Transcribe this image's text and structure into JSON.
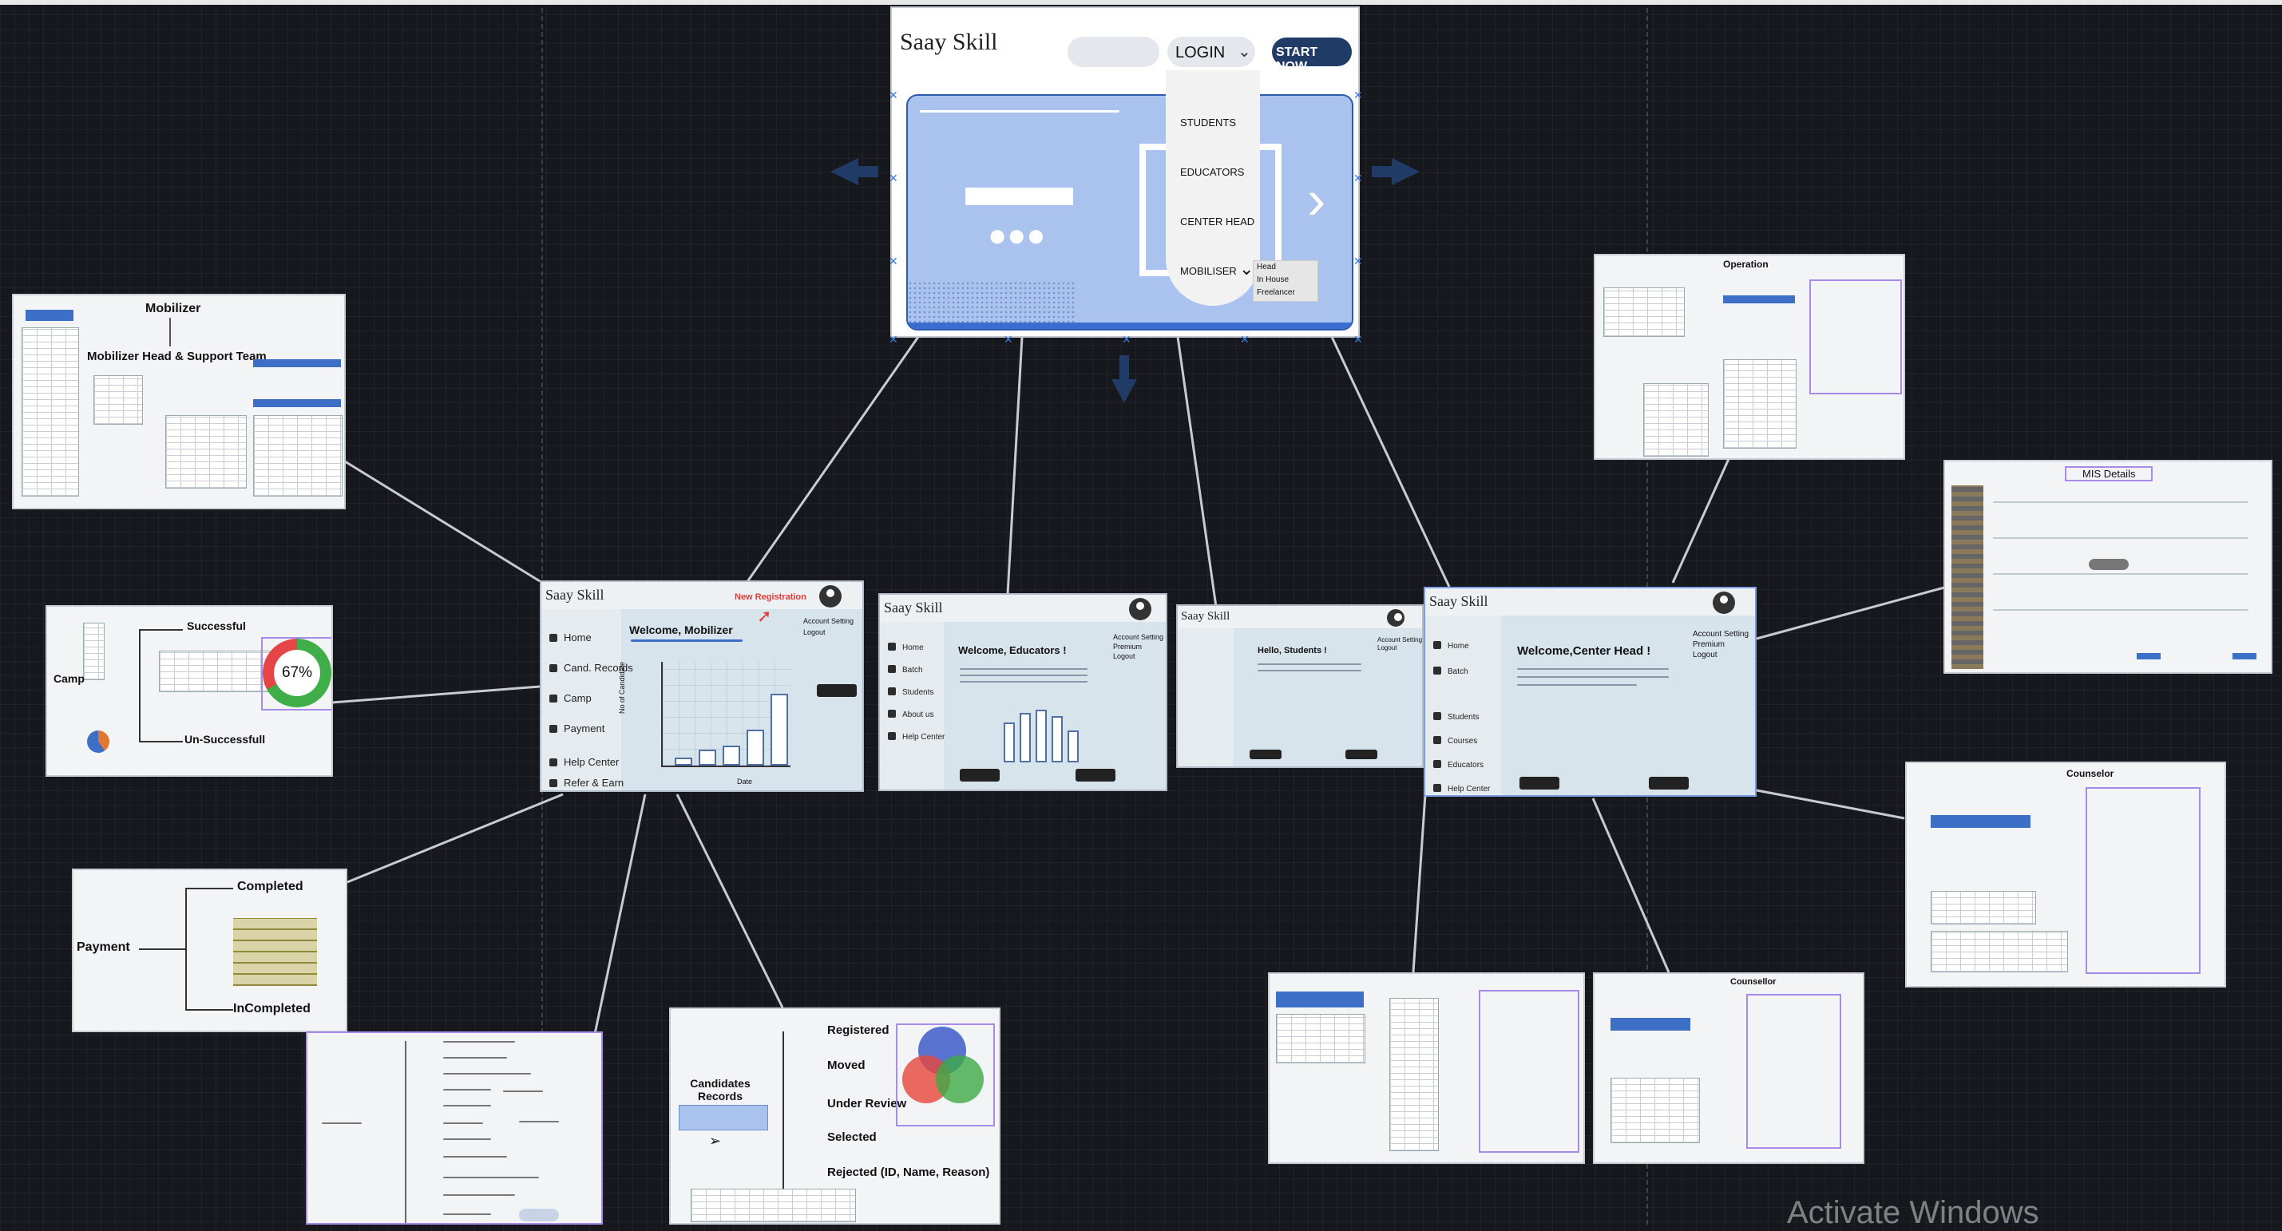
{
  "brand": "Saay Skill",
  "home": {
    "login_label": "LOGIN",
    "start_label": "START NOW",
    "menu": [
      "STUDENTS",
      "EDUCATORS",
      "CENTER HEAD",
      "MOBILISER"
    ],
    "mobiliser_sub": [
      "Head",
      "In House",
      "Freelancer"
    ]
  },
  "mobilizer_board": {
    "title": "Mobilizer",
    "subtitle": "Mobilizer Head & Support Team"
  },
  "camp_board": {
    "camp": "Camp",
    "success": "Successful",
    "unsuccess": "Un-Successfull",
    "percent": "67%"
  },
  "payment_board": {
    "payment": "Payment",
    "completed": "Completed",
    "incompleted": "InCompleted"
  },
  "candidates_board": {
    "title": "Candidates Records",
    "items": [
      "Registered",
      "Moved",
      "Under Review",
      "Selected",
      "Rejected  (ID, Name, Reason)"
    ],
    "venn": [
      "Under Review",
      "Rejected",
      "Selected"
    ]
  },
  "mobilizer_screen": {
    "welcome": "Welcome, Mobilizer",
    "new_reg": "New Registration",
    "nav": [
      "Home",
      "Cand. Records",
      "Camp",
      "Payment",
      "Help Center",
      "Refer & Earn"
    ],
    "account": [
      "Account Setting",
      "Logout"
    ],
    "xlabel": "Date",
    "ylabel": "No of Candidate"
  },
  "educator_screen": {
    "welcome": "Welcome, Educators  !",
    "nav": [
      "Home",
      "Batch",
      "Students",
      "About us",
      "Help Center"
    ],
    "account": [
      "Account Setting",
      "Premium",
      "Logout"
    ]
  },
  "student_screen": {
    "welcome": "Hello, Students  !",
    "account": [
      "Account Setting",
      "Logout"
    ]
  },
  "center_screen": {
    "welcome": "Welcome,Center Head  !",
    "nav": [
      "Home",
      "Batch",
      "Students",
      "Courses",
      "Educators",
      "Help Center"
    ],
    "account": [
      "Account Setting",
      "Premium",
      "Logout"
    ]
  },
  "operation_board": {
    "title": "Operation"
  },
  "mis_board": {
    "title": "MIS Details"
  },
  "counselor_board": {
    "title": "Counselor"
  },
  "counsellor_board": {
    "title": "Counsellor"
  },
  "watermark": "Activate Windows",
  "colors": {
    "accent": "#3e6fc7",
    "new_reg": "#e53935",
    "purple": "#a88be8",
    "start_btn": "#1f3b66"
  }
}
